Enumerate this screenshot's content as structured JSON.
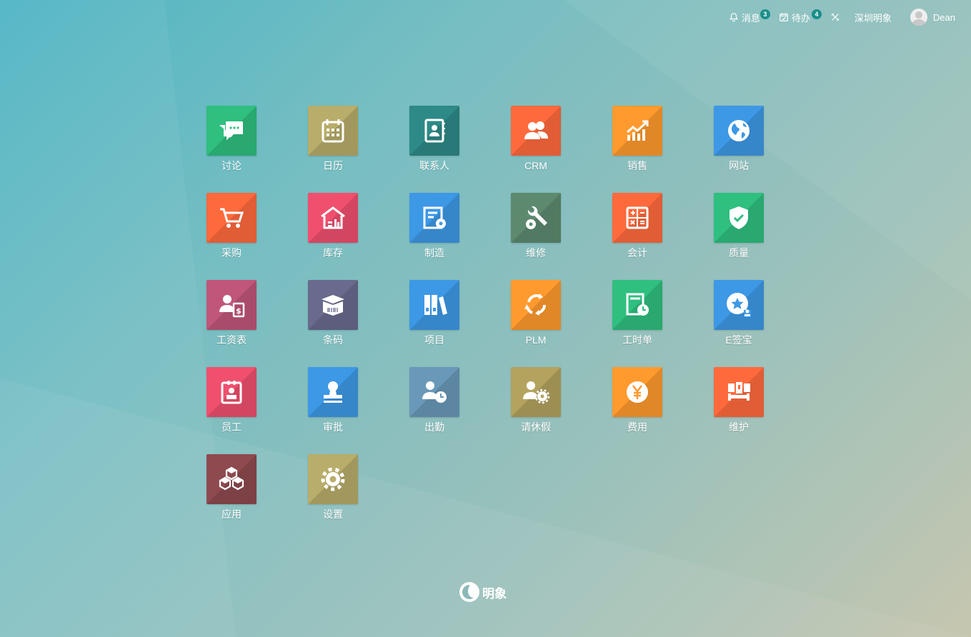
{
  "topbar": {
    "messages": {
      "label": "消息",
      "count": "3",
      "icon": "bell-icon"
    },
    "todo": {
      "label": "待办",
      "count": "4",
      "icon": "calendar-check-icon"
    },
    "tools_icon": "tools-icon",
    "company": "深圳明象",
    "user": "Dean"
  },
  "apps": [
    {
      "label": "讨论",
      "color": "#2fbf7f",
      "icon": "chat-icon"
    },
    {
      "label": "日历",
      "color": "#b8ad6a",
      "icon": "calendar-icon"
    },
    {
      "label": "联系人",
      "color": "#2d8a87",
      "icon": "contacts-icon"
    },
    {
      "label": "CRM",
      "color": "#ff6a3d",
      "icon": "users-icon"
    },
    {
      "label": "销售",
      "color": "#ff9a2e",
      "icon": "sales-chart-icon"
    },
    {
      "label": "网站",
      "color": "#3d98e6",
      "icon": "globe-icon"
    },
    {
      "label": "采购",
      "color": "#ff6a3d",
      "icon": "cart-icon"
    },
    {
      "label": "库存",
      "color": "#f0506e",
      "icon": "warehouse-icon"
    },
    {
      "label": "制造",
      "color": "#3d98e6",
      "icon": "manufacturing-icon"
    },
    {
      "label": "维修",
      "color": "#5d8a6f",
      "icon": "wrench-gear-icon"
    },
    {
      "label": "会计",
      "color": "#ff6a3d",
      "icon": "calculator-icon"
    },
    {
      "label": "质量",
      "color": "#2fbf7f",
      "icon": "shield-check-icon"
    },
    {
      "label": "工资表",
      "color": "#c0567a",
      "icon": "payroll-icon"
    },
    {
      "label": "条码",
      "color": "#6a6a8e",
      "icon": "barcode-box-icon"
    },
    {
      "label": "项目",
      "color": "#3d98e6",
      "icon": "binders-icon"
    },
    {
      "label": "PLM",
      "color": "#ff9a2e",
      "icon": "recycle-icon"
    },
    {
      "label": "工时单",
      "color": "#2fbf7f",
      "icon": "timesheet-icon"
    },
    {
      "label": "E签宝",
      "color": "#3d98e6",
      "icon": "esign-icon"
    },
    {
      "label": "员工",
      "color": "#f0506e",
      "icon": "employee-badge-icon"
    },
    {
      "label": "审批",
      "color": "#3d98e6",
      "icon": "stamp-icon"
    },
    {
      "label": "出勤",
      "color": "#6a98b8",
      "icon": "user-clock-icon"
    },
    {
      "label": "请休假",
      "color": "#b3a35f",
      "icon": "user-gear-icon"
    },
    {
      "label": "费用",
      "color": "#ff9a2e",
      "icon": "yen-icon"
    },
    {
      "label": "维护",
      "color": "#ff6a3d",
      "icon": "maintenance-icon"
    },
    {
      "label": "应用",
      "color": "#8e4a4f",
      "icon": "cubes-icon"
    },
    {
      "label": "设置",
      "color": "#b8ad6a",
      "icon": "settings-gear-icon"
    }
  ],
  "footer": {
    "brand": "明象"
  }
}
